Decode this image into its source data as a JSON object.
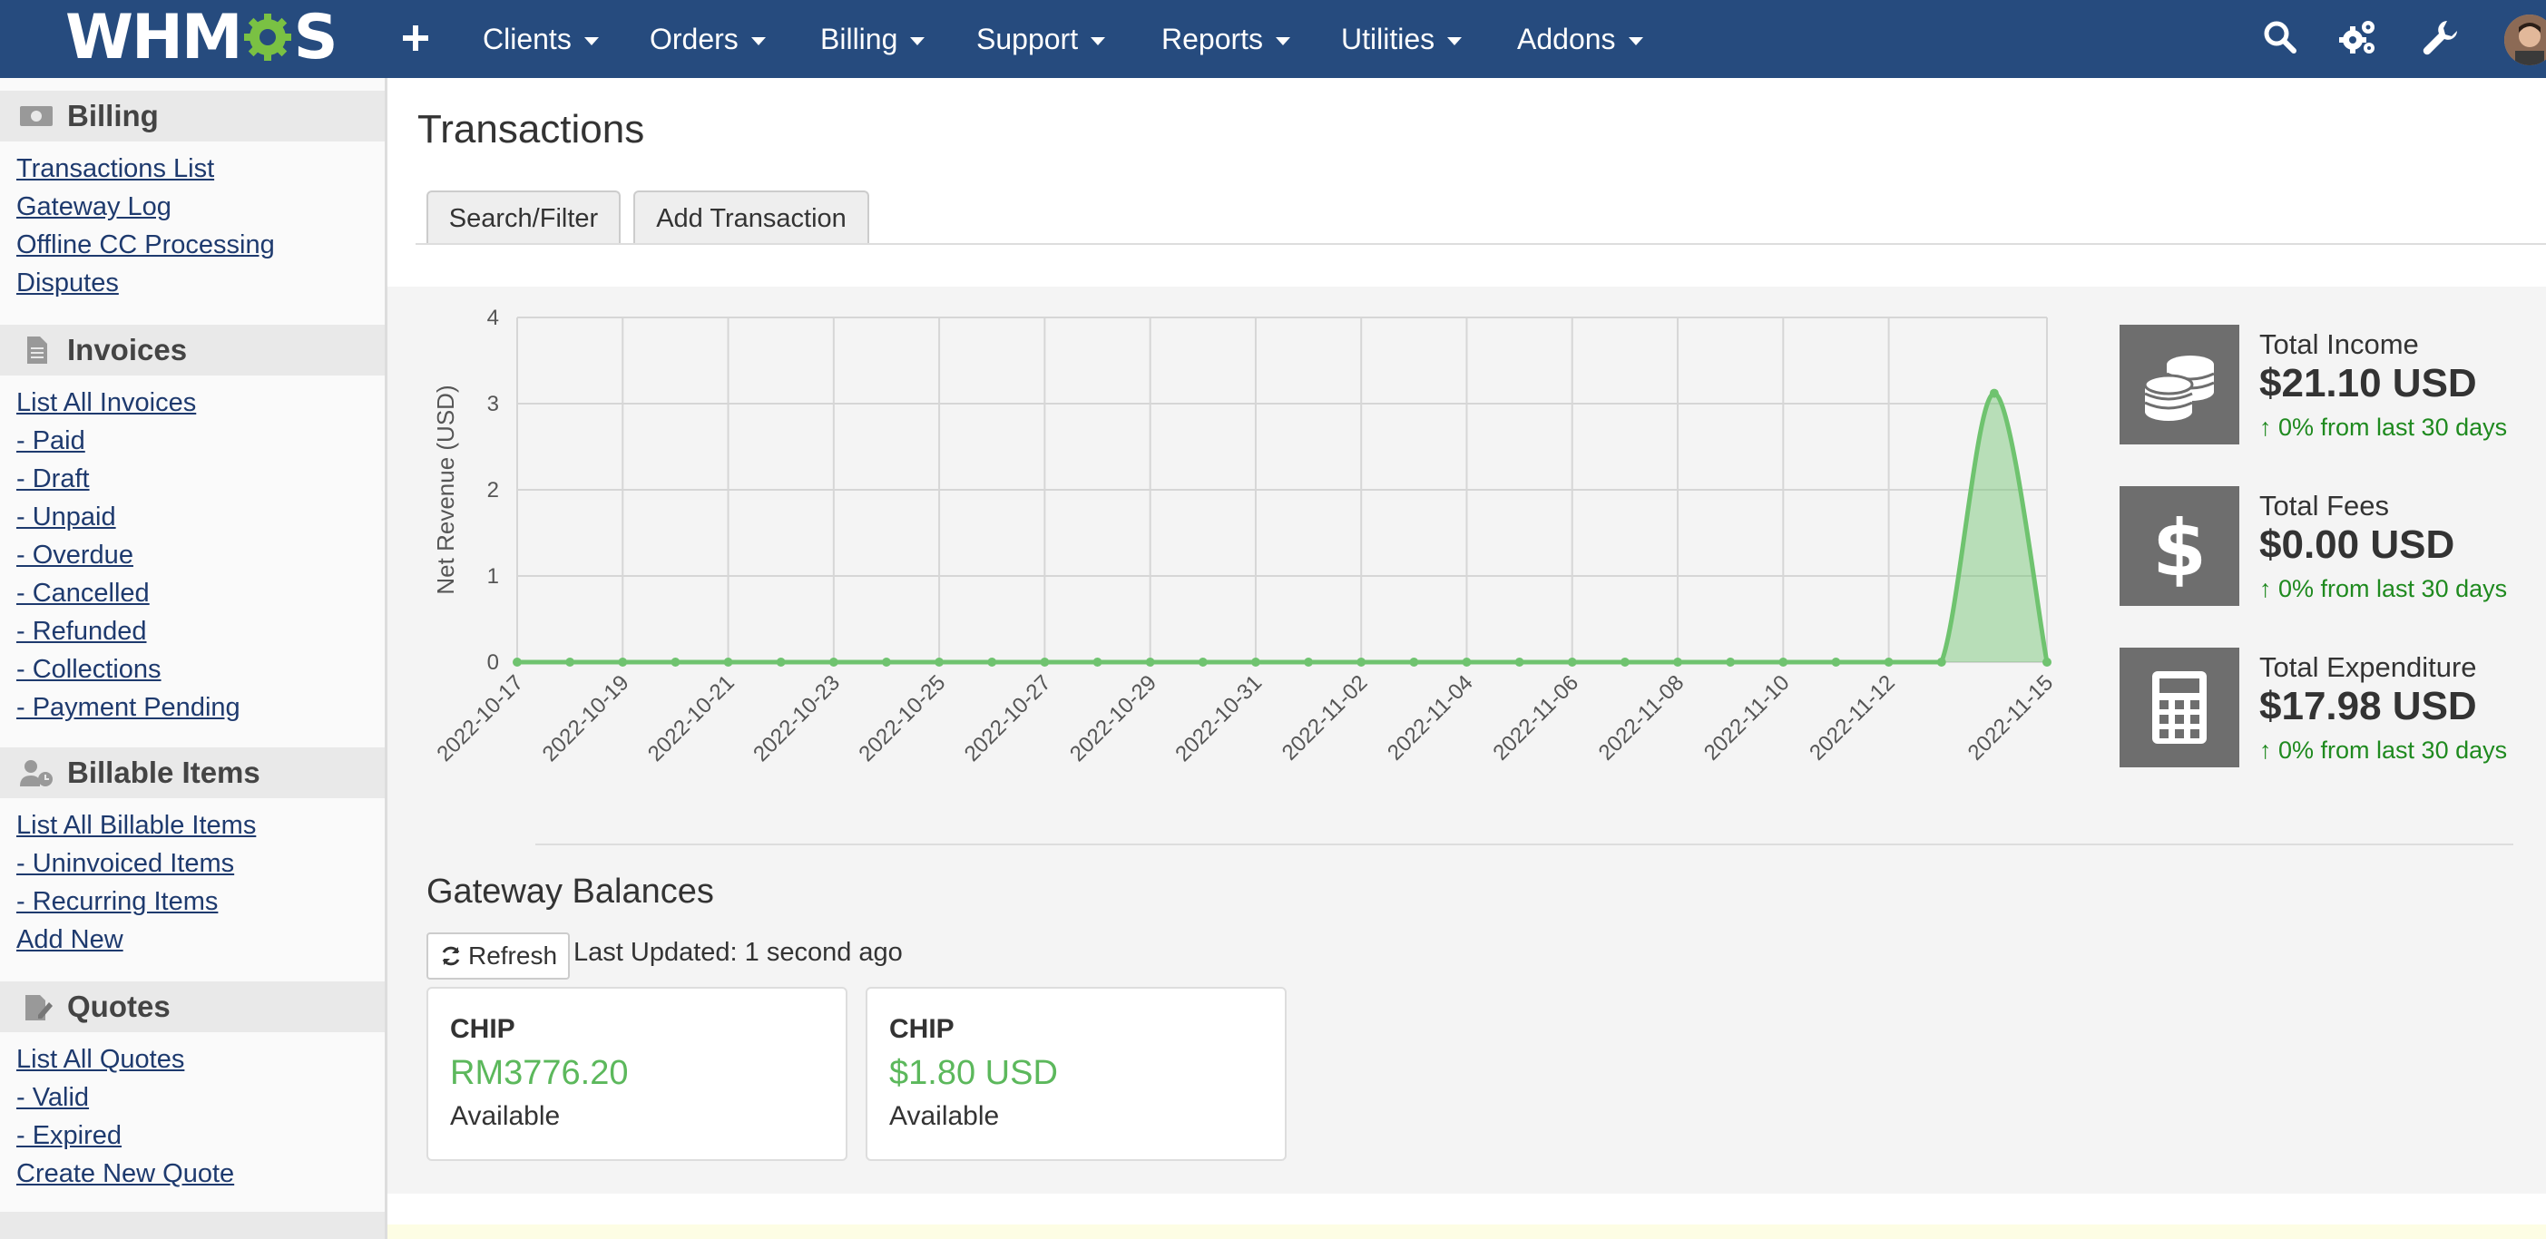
{
  "brand": {
    "logo_text_left": "WHM",
    "logo_text_right": "S"
  },
  "nav": {
    "items": [
      {
        "label": "Clients"
      },
      {
        "label": "Orders"
      },
      {
        "label": "Billing"
      },
      {
        "label": "Support"
      },
      {
        "label": "Reports"
      },
      {
        "label": "Utilities"
      },
      {
        "label": "Addons"
      }
    ],
    "plus_icon": "plus-icon",
    "right_icons": [
      "search-icon",
      "cogs-icon",
      "wrench-icon",
      "avatar"
    ]
  },
  "sidebar": {
    "sections": [
      {
        "title": "Billing",
        "icon": "money-icon",
        "links": [
          "Transactions List",
          "Gateway Log",
          "Offline CC Processing",
          "Disputes"
        ]
      },
      {
        "title": "Invoices",
        "icon": "document-icon",
        "links": [
          "List All Invoices",
          "- Paid",
          "- Draft",
          "- Unpaid",
          "- Overdue",
          "- Cancelled",
          "- Refunded",
          "- Collections",
          "- Payment Pending"
        ]
      },
      {
        "title": "Billable Items",
        "icon": "user-clock-icon",
        "links": [
          "List All Billable Items",
          "- Uninvoiced Items",
          "- Recurring Items",
          "Add New"
        ]
      },
      {
        "title": "Quotes",
        "icon": "quote-edit-icon",
        "links": [
          "List All Quotes",
          "- Valid",
          "- Expired",
          "Create New Quote"
        ]
      }
    ]
  },
  "main": {
    "title": "Transactions",
    "tabs": [
      "Search/Filter",
      "Add Transaction"
    ]
  },
  "stats": [
    {
      "label": "Total Income",
      "value": "$21.10 USD",
      "trend": "0% from last 30 days",
      "icon": "coins-icon"
    },
    {
      "label": "Total Fees",
      "value": "$0.00 USD",
      "trend": "0% from last 30 days",
      "icon": "dollar-icon"
    },
    {
      "label": "Total Expenditure",
      "value": "$17.98 USD",
      "trend": "0% from last 30 days",
      "icon": "calculator-icon"
    }
  ],
  "gateway": {
    "title": "Gateway Balances",
    "refresh_label": "Refresh",
    "last_updated": "Last Updated: 1 second ago",
    "cards": [
      {
        "name": "CHIP",
        "amount": "RM3776.20",
        "status": "Available"
      },
      {
        "name": "CHIP",
        "amount": "$1.80 USD",
        "status": "Available"
      }
    ]
  },
  "colors": {
    "nav_bg": "#264b7e",
    "accent_green": "#5cb85c",
    "trend_green": "#1f8a1f",
    "icon_box": "#6e6e6e",
    "link": "#1e3a6e"
  },
  "chart_data": {
    "type": "area",
    "ylabel": "Net Revenue (USD)",
    "xlabel": "",
    "ylim": [
      0,
      4
    ],
    "yticks": [
      0,
      1,
      2,
      3,
      4
    ],
    "x_tick_labels": [
      "2022-10-17",
      "2022-10-19",
      "2022-10-21",
      "2022-10-23",
      "2022-10-25",
      "2022-10-27",
      "2022-10-29",
      "2022-10-31",
      "2022-11-02",
      "2022-11-04",
      "2022-11-06",
      "2022-11-08",
      "2022-11-10",
      "2022-11-12",
      "2022-11-15"
    ],
    "x": [
      "2022-10-17",
      "2022-10-18",
      "2022-10-19",
      "2022-10-20",
      "2022-10-21",
      "2022-10-22",
      "2022-10-23",
      "2022-10-24",
      "2022-10-25",
      "2022-10-26",
      "2022-10-27",
      "2022-10-28",
      "2022-10-29",
      "2022-10-30",
      "2022-10-31",
      "2022-11-01",
      "2022-11-02",
      "2022-11-03",
      "2022-11-04",
      "2022-11-05",
      "2022-11-06",
      "2022-11-07",
      "2022-11-08",
      "2022-11-09",
      "2022-11-10",
      "2022-11-11",
      "2022-11-12",
      "2022-11-13",
      "2022-11-14",
      "2022-11-15"
    ],
    "series": [
      {
        "values": [
          0,
          0,
          0,
          0,
          0,
          0,
          0,
          0,
          0,
          0,
          0,
          0,
          0,
          0,
          0,
          0,
          0,
          0,
          0,
          0,
          0,
          0,
          0,
          0,
          0,
          0,
          0,
          0,
          3.12,
          0
        ]
      }
    ],
    "grid": true,
    "color": "#6fc36f"
  }
}
